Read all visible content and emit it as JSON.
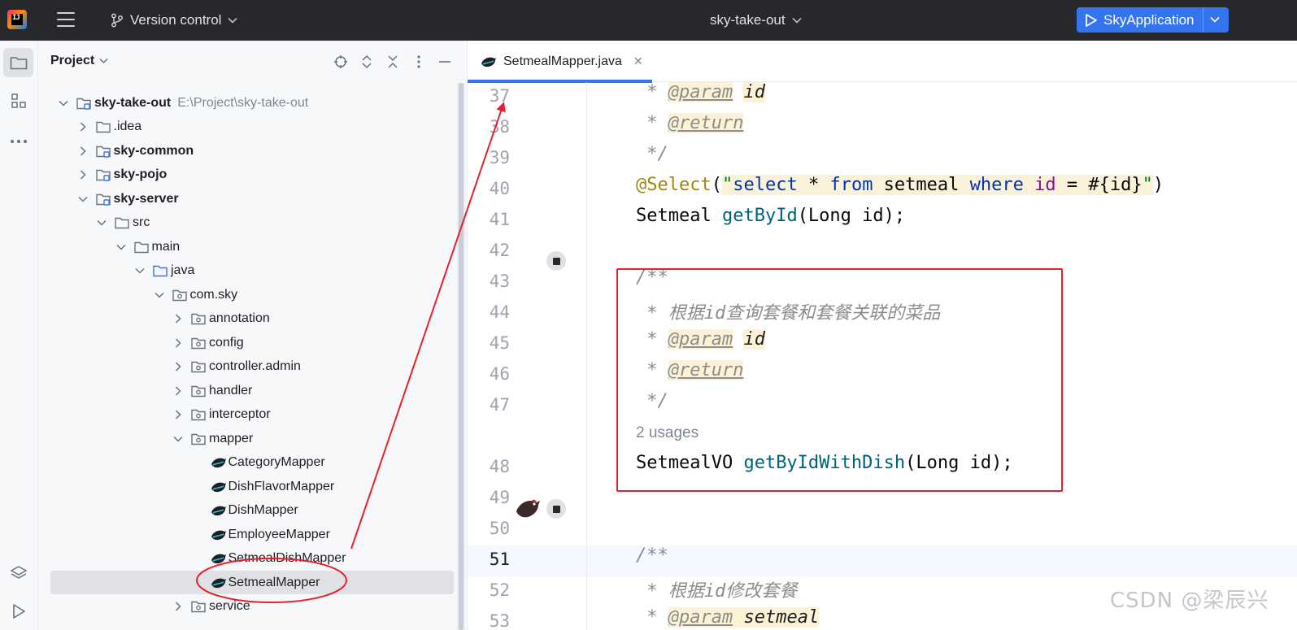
{
  "titlebar": {
    "vcs_label": "Version control",
    "project_name": "sky-take-out",
    "run_config": "SkyApplication"
  },
  "project_panel": {
    "title": "Project",
    "tree": [
      {
        "label": "sky-take-out",
        "path": "E:\\Project\\sky-take-out",
        "bold": true,
        "expanded": true,
        "type": "module"
      },
      {
        "label": ".idea",
        "expanded": false,
        "type": "folder"
      },
      {
        "label": "sky-common",
        "bold": true,
        "expanded": false,
        "type": "module"
      },
      {
        "label": "sky-pojo",
        "bold": true,
        "expanded": false,
        "type": "module"
      },
      {
        "label": "sky-server",
        "bold": true,
        "expanded": true,
        "type": "module"
      },
      {
        "label": "src",
        "expanded": true,
        "type": "folder"
      },
      {
        "label": "main",
        "expanded": true,
        "type": "folder"
      },
      {
        "label": "java",
        "expanded": true,
        "type": "source"
      },
      {
        "label": "com.sky",
        "expanded": true,
        "type": "package"
      },
      {
        "label": "annotation",
        "expanded": false,
        "type": "package"
      },
      {
        "label": "config",
        "expanded": false,
        "type": "package"
      },
      {
        "label": "controller.admin",
        "expanded": false,
        "type": "package"
      },
      {
        "label": "handler",
        "expanded": false,
        "type": "package"
      },
      {
        "label": "interceptor",
        "expanded": false,
        "type": "package"
      },
      {
        "label": "mapper",
        "expanded": true,
        "type": "package"
      },
      {
        "label": "CategoryMapper",
        "type": "mybatis"
      },
      {
        "label": "DishFlavorMapper",
        "type": "mybatis"
      },
      {
        "label": "DishMapper",
        "type": "mybatis"
      },
      {
        "label": "EmployeeMapper",
        "type": "mybatis"
      },
      {
        "label": "SetmealDishMapper",
        "type": "mybatis"
      },
      {
        "label": "SetmealMapper",
        "type": "mybatis",
        "selected": true
      },
      {
        "label": "service",
        "expanded": false,
        "type": "package"
      }
    ]
  },
  "editor": {
    "tab_label": "SetmealMapper.java",
    "line_numbers": [
      "37",
      "38",
      "39",
      "40",
      "41",
      "42",
      "43",
      "44",
      "45",
      "46",
      "47",
      "48",
      "49",
      "50",
      "51",
      "52",
      "53"
    ],
    "code": {
      "l37_star": " * ",
      "l37_tag": "@param",
      "l37_id": "id",
      "l38_star": " * ",
      "l38_tag": "@return",
      "l39": " */",
      "l40_ann": "@Select",
      "l40_p1": "(",
      "l40_q1": "\"",
      "l40_select": "select",
      "l40_star": " * ",
      "l40_from": "from",
      "l40_tbl": " setmeal ",
      "l40_where": "where",
      "l40_sp": " ",
      "l40_id": "id",
      "l40_eq": " = #{id}",
      "l40_q2": "\"",
      "l40_p2": ")",
      "l41_type": "Setmeal ",
      "l41_method": "getById",
      "l41_args": "(Long id);",
      "l43": "/**",
      "l44": " * 根据id查询套餐和套餐关联的菜品",
      "l45_star": " * ",
      "l45_tag": "@param",
      "l45_id": "id",
      "l46_star": " * ",
      "l46_tag": "@return",
      "l47": " */",
      "usages": "2 usages",
      "l48_type": "SetmealVO ",
      "l48_method": "getByIdWithDish",
      "l48_args": "(Long id);",
      "l51": "/**",
      "l52": " * 根据id修改套餐",
      "l53_star": " * ",
      "l53_tag": "@param",
      "l53_rest": " setmeal"
    }
  },
  "watermark": "CSDN @梁辰兴",
  "colors": {
    "accent": "#3574f0",
    "annotation_red": "#e8202a",
    "titlebar_bg": "#27282c"
  }
}
